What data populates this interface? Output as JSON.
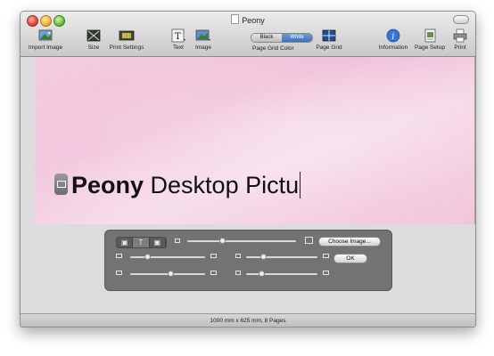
{
  "window": {
    "title": "Peony"
  },
  "toolbar": {
    "items": [
      {
        "label": "Import Image",
        "icon": "import-image-icon"
      },
      {
        "label": "Size",
        "icon": "size-icon"
      },
      {
        "label": "Print Settings",
        "icon": "print-settings-icon"
      },
      {
        "label": "Text",
        "icon": "text-icon"
      },
      {
        "label": "Image",
        "icon": "image-icon"
      },
      {
        "label": "Page Grid",
        "icon": "page-grid-icon"
      },
      {
        "label": "Information",
        "icon": "info-icon"
      },
      {
        "label": "Page Setup",
        "icon": "page-setup-icon"
      },
      {
        "label": "Print",
        "icon": "printer-icon"
      }
    ],
    "grid_color": {
      "label": "Page Grid Color",
      "options": [
        "Black",
        "White"
      ],
      "selected": "White"
    }
  },
  "canvas": {
    "text_bold": "Peony",
    "text_regular": " Desktop Pictu"
  },
  "hud": {
    "choose_image_label": "Choose Image...",
    "ok_label": "OK"
  },
  "status": {
    "text": "1000 mm  x  625 mm, 8 Pages"
  },
  "colors": {
    "canvas_pink": "#efbdd6",
    "hud_gray": "#696969",
    "segment_selected": "#3f6fb8"
  }
}
